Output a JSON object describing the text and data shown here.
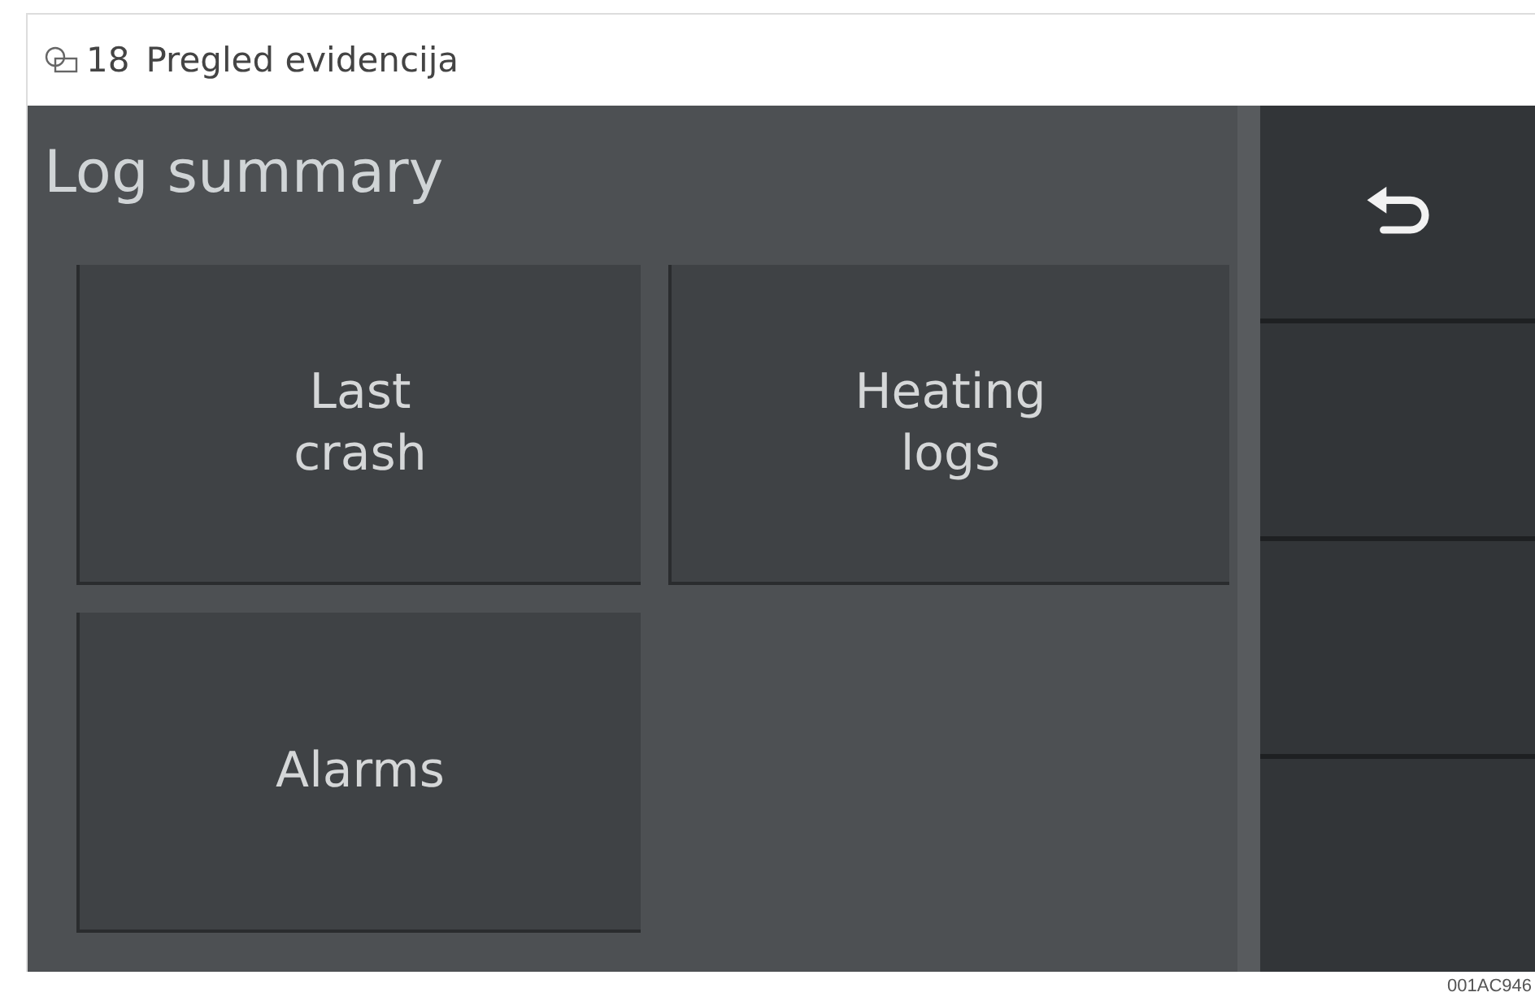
{
  "figure": {
    "number": "18",
    "title": "Pregled evidencija"
  },
  "screen": {
    "title": "Log summary",
    "tiles": [
      {
        "label": "Last\ncrash"
      },
      {
        "label": "Heating\nlogs"
      },
      {
        "label": "Alarms"
      }
    ],
    "side_buttons": [
      {
        "kind": "back"
      },
      {
        "kind": "blank"
      },
      {
        "kind": "blank"
      },
      {
        "kind": "blank"
      }
    ]
  },
  "image_code": "001AC946"
}
